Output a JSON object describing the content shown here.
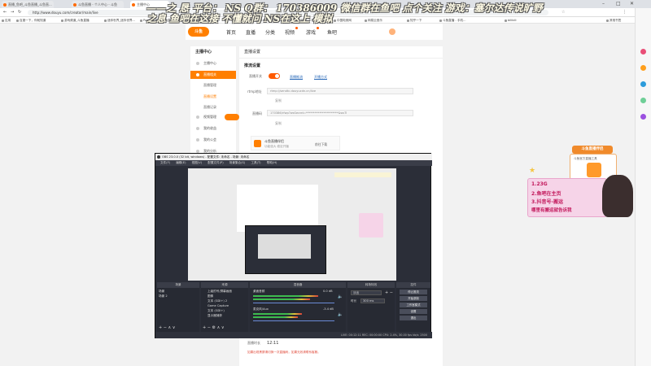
{
  "browser": {
    "tabs": [
      {
        "label": "直播_鱼吧_斗鱼直播_斗鱼直..."
      },
      {
        "label": "斗鱼直播 - 个人中心 - 斗鱼"
      },
      {
        "label": "主播中心"
      }
    ],
    "url": "http://www.douyu.com/creator/main/live",
    "bookmarks": [
      "应用",
      "百度一下，你就知道",
      "游戏频道_斗鱼直播",
      "迷你世界_迷你世界...",
      "Pad",
      "游戏_斗鱼直播",
      "DataFun数据科技...",
      "视频剪辑之家_斗鱼...",
      "[已完成] 手机...",
      "中国电竞网",
      "网易云音乐",
      "知乎一下",
      "斗鱼直播 - 手机...",
      "bilibili",
      "其他书签"
    ]
  },
  "banner": {
    "line1": "——之 恳   平台： NS   Q群： 170386009   微信群在鱼吧   点个关注   游戏：塞尔达传说旷野",
    "line2": "之息  鱼吧在这接  不懂就问 NS在这上   模拟"
  },
  "douyu": {
    "logo": "斗鱼",
    "nav": [
      "首页",
      "直播",
      "分类",
      "视频",
      "游戏",
      "鱼吧"
    ],
    "sidebar_title": "主播中心",
    "sidebar_items": [
      "主播中心",
      "直播相关",
      "直播管理",
      "直播设置",
      "直播记录",
      "视频管理",
      "我的收益",
      "我的公会",
      "我的分析"
    ],
    "main_title": "直播设置",
    "section": "推流设置",
    "toggle_label": "直播开关",
    "links": [
      "直播推流",
      "开播方式"
    ],
    "rtmp_label": "rtmp地址",
    "rtmp_value": "rtmp://sendtc.douyucdn.cn/live",
    "rtmp_copy": "复制",
    "code_label": "直播码",
    "code_value": "170386/rfwp?wsSecret=**********************&wsTi",
    "code_copy": "复制",
    "tool_title": "斗鱼直播伴侣",
    "tool_desc": "功能强大 稳定开播",
    "tool_download": "前往下载",
    "bottom_label": "直播时长",
    "bottom_value": "12:11",
    "bottom_note": "如果出现黑屏请切换一次直播码，如果无效请联系客服。"
  },
  "obs": {
    "title": "OBS 23.0.0 (32 bit, windows) - 配置文件: 未命名 - 场景: 未命名",
    "menu": [
      "文件(F)",
      "编辑(E)",
      "视图(V)",
      "配置文件(P)",
      "场景集合(S)",
      "工具(T)",
      "帮助(H)"
    ],
    "panels": [
      "场景",
      "来源",
      "混音器",
      "转场特效",
      "控件"
    ],
    "scenes": [
      "场景",
      "场景 2"
    ],
    "sources": [
      "上级的号/屏幕画面",
      "图像",
      "文本 (GDI+) 2",
      "Game Capture",
      "文本 (GDI+)",
      "显示器捕获"
    ],
    "mixer": [
      "桌面音频",
      "麦克风/Aux"
    ],
    "mixer_db": [
      "0.0 dB",
      "-3.4 dB"
    ],
    "transition": "淡出",
    "duration_label": "时长",
    "duration": "300 ms",
    "controls": [
      "停止推流",
      "开始录制",
      "工作室模式",
      "设置",
      "退出"
    ],
    "status": "LIVE: 00:12:11   REC: 00:00:00   CPU: 2.4%, 30.00 fps   kb/s: 2500"
  },
  "promo": {
    "badge": "斗鱼直播伴侣",
    "card_text": "斗鱼官方直播工具",
    "lines": [
      "1.23G",
      "2.鱼吧在主页",
      "3.抖音号-搬运",
      "哪里有搬运就告诉我"
    ]
  },
  "colors": {
    "brand": "#ff7f00",
    "obs_bg": "#2b2e38",
    "promo_pink": "#f6d4e8"
  }
}
